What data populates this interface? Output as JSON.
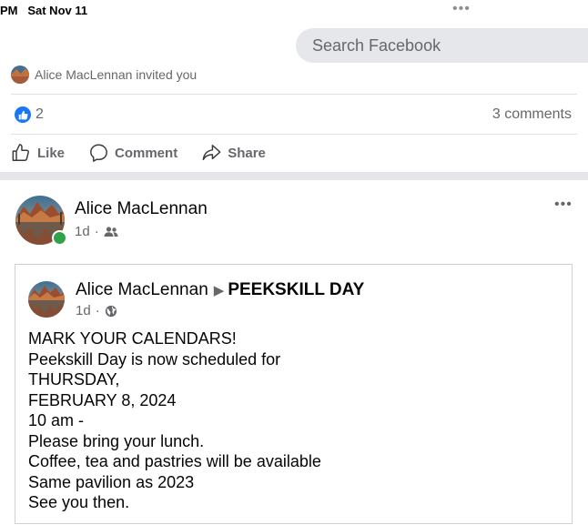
{
  "status_bar": {
    "time": "PM   Sat Nov 11",
    "dots": "•••"
  },
  "search": {
    "placeholder": "Search Facebook"
  },
  "previous_post": {
    "invited_text": "Alice MacLennan invited you",
    "reaction_count": "2",
    "comments_count": "3 comments",
    "actions": {
      "like": "Like",
      "comment": "Comment",
      "share": "Share"
    }
  },
  "post": {
    "author": "Alice MacLennan",
    "time": "1d",
    "more": "•••",
    "audience_icon": "friends-icon",
    "shared": {
      "author": "Alice MacLennan",
      "arrow": "▶",
      "group": "PEEKSKILL DAY",
      "time": "1d",
      "audience_icon": "globe-icon",
      "lines": [
        "MARK YOUR CALENDARS!",
        "Peekskill Day is now scheduled for",
        "THURSDAY,",
        "FEBRUARY 8, 2024",
        "10 am -",
        "Please bring your lunch.",
        "Coffee, tea and pastries will be available",
        "Same pavilion as 2023",
        "See you then."
      ]
    }
  },
  "colors": {
    "facebook_blue": "#1877f2",
    "secondary_text": "#65676b",
    "online_green": "#31a24c",
    "search_bg": "#e6e7ea",
    "separator": "#e4e6eb"
  }
}
